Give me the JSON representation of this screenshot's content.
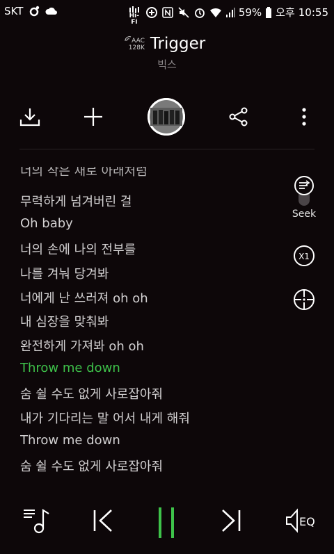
{
  "status_bar": {
    "carrier": "SKT",
    "hifi_label": "Hi-Fi",
    "battery_percent": "59%",
    "ampm": "오후",
    "time": "10:55"
  },
  "song": {
    "codec_line1": "AAC",
    "codec_line2": "128K",
    "title": "Trigger",
    "artist": "빅스"
  },
  "toolbar": {
    "download_icon": "download-icon",
    "add_icon": "plus-icon",
    "share_icon": "share-icon",
    "more_icon": "more-vertical-icon"
  },
  "lyrics": {
    "partial_top": "너의 작은 새로 아래처럼",
    "lines": [
      "무력하게 넘겨버린 걸",
      "Oh baby",
      "너의 손에 나의 전부를",
      "나를 겨눠 당겨봐",
      "너에게 난 쓰러져 oh oh",
      "내 심장을 맞춰봐",
      "완전하게 가져봐 oh oh",
      "Throw me down",
      "숨 쉴 수도 없게 사로잡아줘",
      "내가 기다리는 말 어서 내게 해줘",
      "Throw me down",
      "숨 쉴 수도 없게 사로잡아줘"
    ],
    "active_index": 7,
    "active_color": "#3ec24a"
  },
  "side_controls": {
    "seek_label": "Seek",
    "speed_label": "X1"
  },
  "playback": {
    "eq_label": "EQ",
    "state": "playing",
    "pause_color": "#3ec24a"
  }
}
